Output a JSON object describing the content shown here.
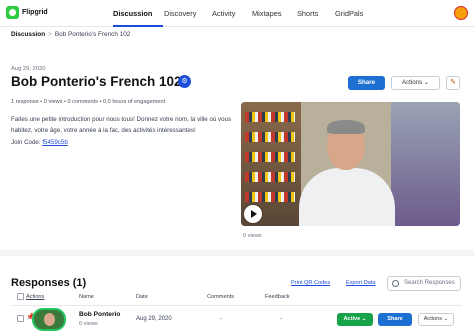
{
  "app": {
    "logo_text": "Flipgrid"
  },
  "nav": {
    "items": [
      {
        "label": "Discussion",
        "active": true
      },
      {
        "label": "Discovery"
      },
      {
        "label": "Activity"
      },
      {
        "label": "Mixtapes"
      },
      {
        "label": "Shorts"
      },
      {
        "label": "GridPals"
      }
    ]
  },
  "breadcrumb": {
    "root": "Discussion",
    "separator": ">",
    "current": "Bob Ponterio's French 102"
  },
  "topic": {
    "date": "Aug 29, 2020",
    "title": "Bob Ponterio's French 102",
    "share_label": "Share",
    "actions_label": "Actions",
    "meta": "1 response • 0 views • 0 comments • 0.0 hours of engagement",
    "description": "Faites une petite introduction pour nous tous! Donnez votre nom, la ville où vous habitez, votre âge, votre année à la fac, des activités intéressantes!",
    "join_prefix": "Join Code:",
    "join_code": "f5459c5b",
    "video_views": "0 views"
  },
  "responses": {
    "title": "Responses (1)",
    "print_qr": "Print QR Codes",
    "export": "Export Data",
    "search_placeholder": "Search Responses",
    "columns": {
      "actions": "Actions",
      "name": "Name",
      "date": "Date",
      "comments": "Comments",
      "feedback": "Feedback"
    },
    "rows": [
      {
        "name": "Bob Ponterio",
        "views": "0 views",
        "date": "Aug 29, 2020",
        "comments": "-",
        "feedback": "-",
        "status": "Active",
        "share": "Share",
        "actions": "Actions"
      }
    ]
  },
  "colors": {
    "accent": "#1d6fd1",
    "active": "#16a34a",
    "brand": "#2ecc40"
  }
}
